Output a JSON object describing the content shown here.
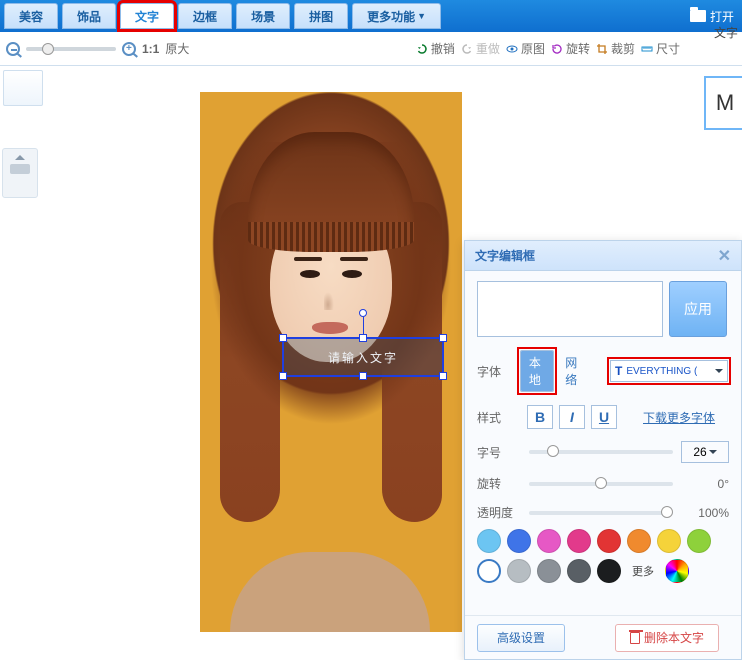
{
  "topbar": {
    "tabs": [
      "美容",
      "饰品",
      "文字",
      "边框",
      "场景",
      "拼图",
      "更多功能"
    ],
    "active_index": 2,
    "open": "打开"
  },
  "toolbar": {
    "ratio": "1:1",
    "original_size": "原大",
    "undo": "撤销",
    "redo": "重做",
    "original_image": "原图",
    "rotate": "旋转",
    "crop": "裁剪",
    "dimensions": "尺寸",
    "right_label": "文字",
    "swatch": "M"
  },
  "canvas": {
    "text_placeholder": "请输入文字"
  },
  "panel": {
    "title": "文字编辑框",
    "apply": "应用",
    "text_value": "",
    "font_label": "字体",
    "font_source": {
      "local": "本地",
      "remote": "网络"
    },
    "font_name": "EVERYTHING (",
    "style_label": "样式",
    "bold": "B",
    "italic": "I",
    "underline": "U",
    "more_fonts": "下载更多字体",
    "size_label": "字号",
    "size_value": "26",
    "rotate_label": "旋转",
    "rotate_value": "0°",
    "opacity_label": "透明度",
    "opacity_value": "100%",
    "colors_row1": [
      "#6cc5f2",
      "#3f74e8",
      "#e658c5",
      "#e23a8b",
      "#e23434",
      "#f08a2e",
      "#f5d33a"
    ],
    "colors_row2": [
      "#8ed13b",
      "#ffffff",
      "#b6bdc2",
      "#8a9097",
      "#595f65",
      "#1b1d1f"
    ],
    "more_swatch": "更多",
    "rainbow": "rainbow",
    "advanced": "高级设置",
    "delete": "删除本文字"
  }
}
